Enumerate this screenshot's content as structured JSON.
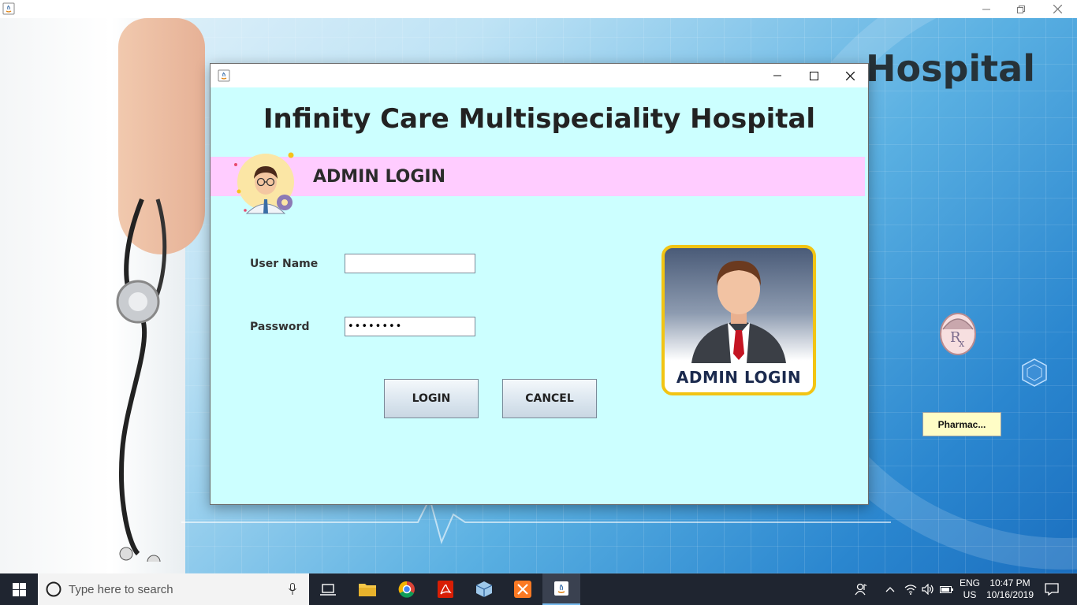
{
  "outer_window": {
    "background_heading": "Hospital",
    "pharmacy_button": "Pharmac..."
  },
  "dialog": {
    "hospital_title": "Infinity Care Multispeciality Hospital",
    "banner_label": "ADMIN LOGIN",
    "username_label": "User Name",
    "username_value": "",
    "password_label": "Password",
    "password_value": "••••••••",
    "login_button": "LOGIN",
    "cancel_button": "CANCEL",
    "badge_label": "ADMIN LOGIN"
  },
  "taskbar": {
    "search_placeholder": "Type here to search",
    "language": "ENG",
    "region": "US",
    "time": "10:47 PM",
    "date": "10/16/2019"
  },
  "colors": {
    "dialog_background": "#ccffff",
    "banner_background": "#ffccff",
    "badge_border": "#f2c413",
    "pharmacy_button_background": "#fffdc6",
    "taskbar_background": "#1f2530"
  }
}
